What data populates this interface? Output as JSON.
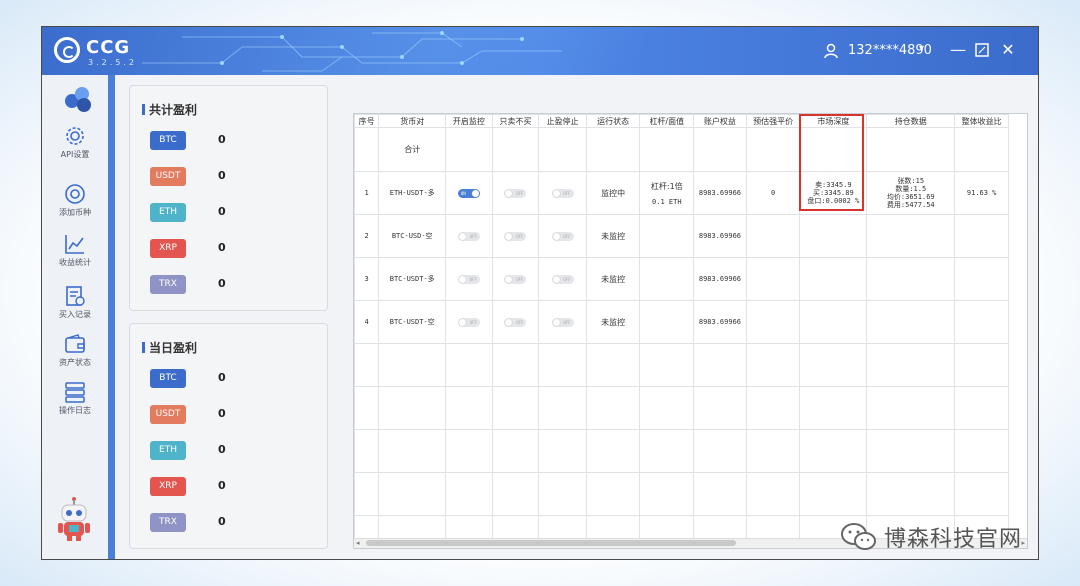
{
  "app": {
    "logo": "CCG",
    "version": "3.2.5.2",
    "user": "132****4890",
    "colors": {
      "titlebar": "#3d6fd0",
      "accent": "#4a7fd8",
      "highlight": "#d9342b"
    }
  },
  "nav": {
    "items": [
      {
        "label": "API设置",
        "icon": "gear-icon"
      },
      {
        "label": "添加币种",
        "icon": "coin-icon"
      },
      {
        "label": "收益统计",
        "icon": "chart-icon"
      },
      {
        "label": "买入记录",
        "icon": "record-icon"
      },
      {
        "label": "资产状态",
        "icon": "wallet-icon"
      },
      {
        "label": "操作日志",
        "icon": "log-icon"
      }
    ]
  },
  "total_profit": {
    "title": "共计盈利",
    "coins": [
      {
        "name": "BTC",
        "value": "0",
        "color": "#3b6ccc"
      },
      {
        "name": "USDT",
        "value": "0",
        "color": "#e37b5f"
      },
      {
        "name": "ETH",
        "value": "0",
        "color": "#4fb3c9"
      },
      {
        "name": "XRP",
        "value": "0",
        "color": "#e3564f"
      },
      {
        "name": "TRX",
        "value": "0",
        "color": "#8f93c6"
      }
    ]
  },
  "daily_profit": {
    "title": "当日盈利",
    "coins": [
      {
        "name": "BTC",
        "value": "0",
        "color": "#3b6ccc"
      },
      {
        "name": "USDT",
        "value": "0",
        "color": "#e37b5f"
      },
      {
        "name": "ETH",
        "value": "0",
        "color": "#4fb3c9"
      },
      {
        "name": "XRP",
        "value": "0",
        "color": "#e3564f"
      },
      {
        "name": "TRX",
        "value": "0",
        "color": "#8f93c6"
      }
    ]
  },
  "table": {
    "headers": [
      "序号",
      "货币对",
      "开启监控",
      "只卖不买",
      "止盈停止",
      "运行状态",
      "杠杆/面值",
      "账户权益",
      "预估强平价",
      "市场深度",
      "持仓数据",
      "整体收益比"
    ],
    "sum_label": "合计",
    "toggle_on": "ON",
    "toggle_off": "OFF",
    "rows": [
      {
        "index": "1",
        "pair": "ETH-USDT-多",
        "monitor": true,
        "sell_only": false,
        "tp_stop": false,
        "status": "监控中",
        "leverage": "杠杆:1倍",
        "face": "0.1 ETH",
        "equity": "8983.69966",
        "liq_price": "0",
        "depth": [
          "卖:3345.9",
          "买:3345.89",
          "盘口:0.0002 %"
        ],
        "position": [
          "张数:15",
          "数量:1.5",
          "均价:3651.69",
          "费用:5477.54"
        ],
        "ratio": "91.63 %"
      },
      {
        "index": "2",
        "pair": "BTC-USD-空",
        "monitor": false,
        "sell_only": false,
        "tp_stop": false,
        "status": "未监控",
        "leverage": "",
        "face": "",
        "equity": "8983.69966",
        "liq_price": "",
        "depth": [],
        "position": [],
        "ratio": ""
      },
      {
        "index": "3",
        "pair": "BTC-USDT-多",
        "monitor": false,
        "sell_only": false,
        "tp_stop": false,
        "status": "未监控",
        "leverage": "",
        "face": "",
        "equity": "8983.69966",
        "liq_price": "",
        "depth": [],
        "position": [],
        "ratio": ""
      },
      {
        "index": "4",
        "pair": "BTC-USDT-空",
        "monitor": false,
        "sell_only": false,
        "tp_stop": false,
        "status": "未监控",
        "leverage": "",
        "face": "",
        "equity": "8983.69966",
        "liq_price": "",
        "depth": [],
        "position": [],
        "ratio": ""
      }
    ],
    "empty_rows": 5
  },
  "watermark": {
    "text": "博森科技官网",
    "icon": "wechat-icon"
  }
}
